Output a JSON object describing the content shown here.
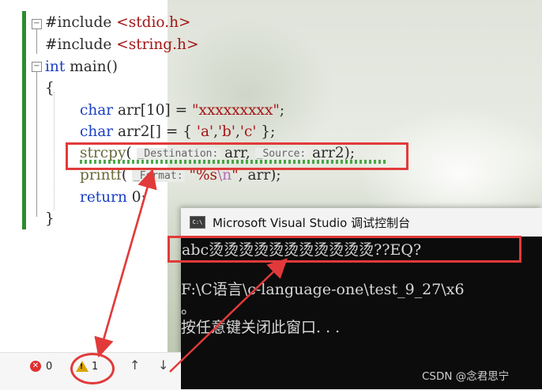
{
  "code": {
    "l1_directive": "#include ",
    "l1_header": "<stdio.h>",
    "l2_directive": "#include ",
    "l2_header": "<string.h>",
    "l3_kw": "int",
    "l3_rest": " main()",
    "l4": "{",
    "l5_kw": "char",
    "l5_mid": " arr[10] = ",
    "l5_str": "\"xxxxxxxxx\"",
    "l5_end": ";",
    "l6_kw": "char",
    "l6_mid": " arr2[] = { ",
    "l6_a": "'a'",
    "l6_b": "'b'",
    "l6_c": "'c'",
    "l6_end": " };",
    "l7_fn": "strcpy",
    "l7_hint1": "_Destination:",
    "l7_arg1": " arr, ",
    "l7_hint2": "_Source:",
    "l7_arg2": " arr2);",
    "l8_fn": "printf",
    "l8_hint": "_Format:",
    "l8_str_a": "\"%s",
    "l8_esc": "\\n",
    "l8_str_b": "\"",
    "l8_rest": ", arr);",
    "l9_kw": "return",
    "l9_rest": " 0;",
    "l10": "}"
  },
  "console": {
    "title": "Microsoft Visual Studio 调试控制台",
    "icon_label": "C:\\",
    "output_line": "abc烫烫烫烫烫烫烫烫烫烫烫??EQ?",
    "path_line": "F:\\C语言\\c-language-one\\test_9_27\\x6",
    "path_cont": "。",
    "prompt_line": "按任意键关闭此窗口. . ."
  },
  "status": {
    "errors": "0",
    "warnings": "1",
    "up": "↑",
    "down": "↓"
  },
  "watermark": "CSDN @念君思宁",
  "colors": {
    "annotation_red": "#e23a3a",
    "keyword": "#1a3fc4",
    "string": "#a31515"
  }
}
